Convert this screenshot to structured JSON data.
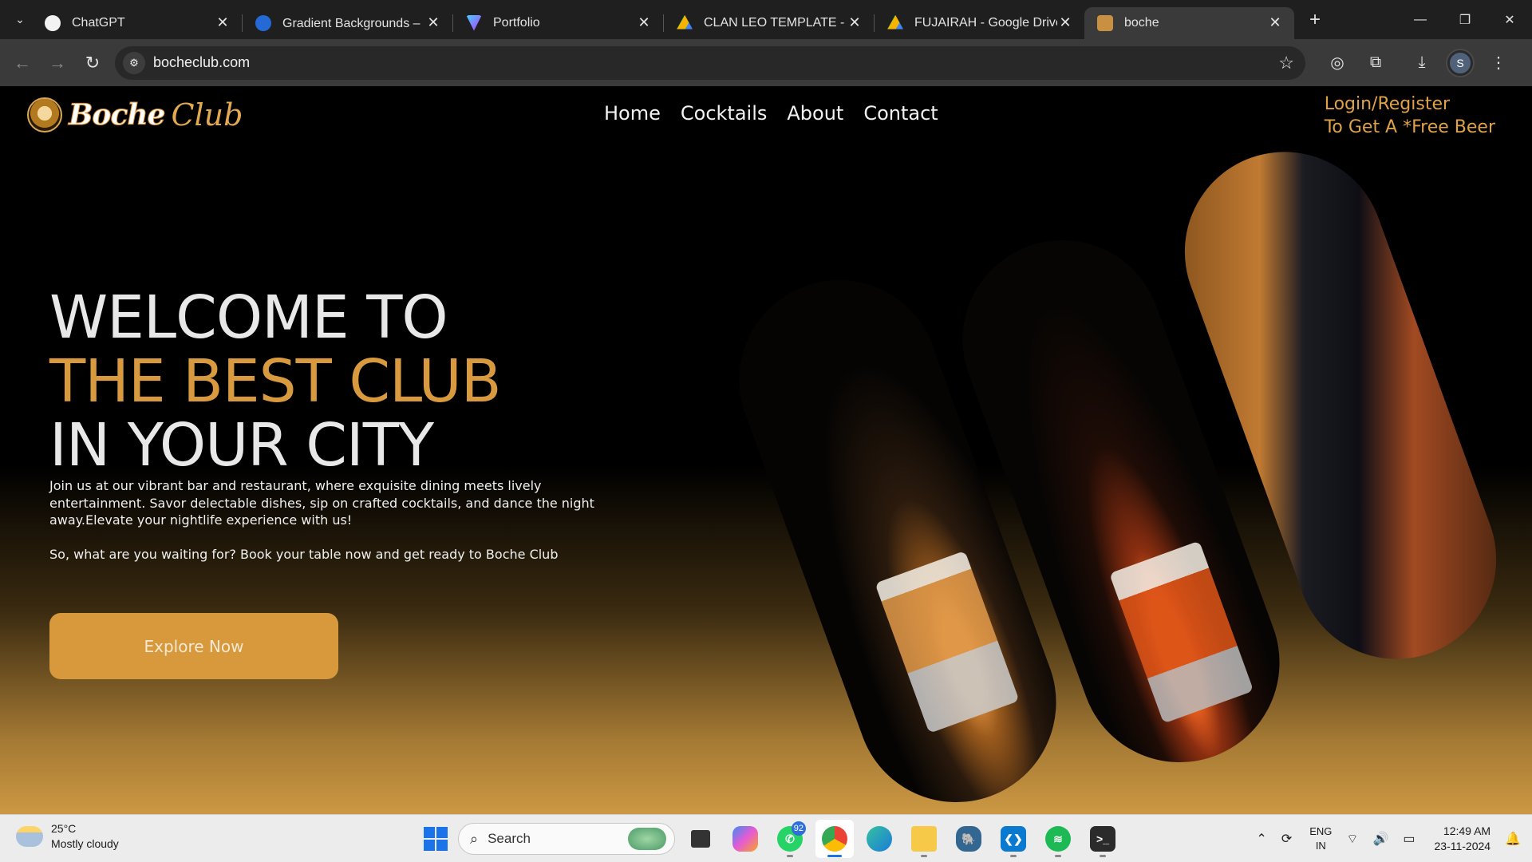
{
  "browser": {
    "tabs": [
      {
        "title": "ChatGPT",
        "color": "#f2f2f2",
        "active": false
      },
      {
        "title": "Gradient Backgrounds – 🌈",
        "color": "#2469d6",
        "active": false
      },
      {
        "title": "Portfolio",
        "color": "#a76cf0",
        "active": false
      },
      {
        "title": "CLAN LEO TEMPLATE - Go",
        "color": "#2da44e",
        "active": false
      },
      {
        "title": "FUJAIRAH - Google Drive",
        "color": "#f4b400",
        "active": false
      },
      {
        "title": "boche",
        "color": "#c89040",
        "active": true
      }
    ],
    "url": "bocheclub.com",
    "profile_initial": "S"
  },
  "site": {
    "logo_text_1": "Boche",
    "logo_text_2": "Club",
    "nav": [
      "Home",
      "Cocktails",
      "About",
      "Contact"
    ],
    "login_line1": "Login/Register",
    "login_line2": "To Get A *Free Beer",
    "hero_line1": "WELCOME TO",
    "hero_line2": "THE BEST CLUB",
    "hero_line3": "IN YOUR CITY",
    "desc_p1": "Join us at our vibrant bar and restaurant, where exquisite dining meets lively entertainment. Savor delectable dishes, sip on crafted cocktails, and dance the night away.Elevate your nightlife experience with us!",
    "desc_p2": "So, what are you waiting for? Book your table now and get ready to Boche Club",
    "cta": "Explore Now",
    "accent": "#d99a3f"
  },
  "taskbar": {
    "weather_temp": "25°C",
    "weather_desc": "Mostly cloudy",
    "search_label": "Search",
    "whatsapp_badge": "92",
    "lang1": "ENG",
    "lang2": "IN",
    "time": "12:49 AM",
    "date": "23-11-2024"
  }
}
